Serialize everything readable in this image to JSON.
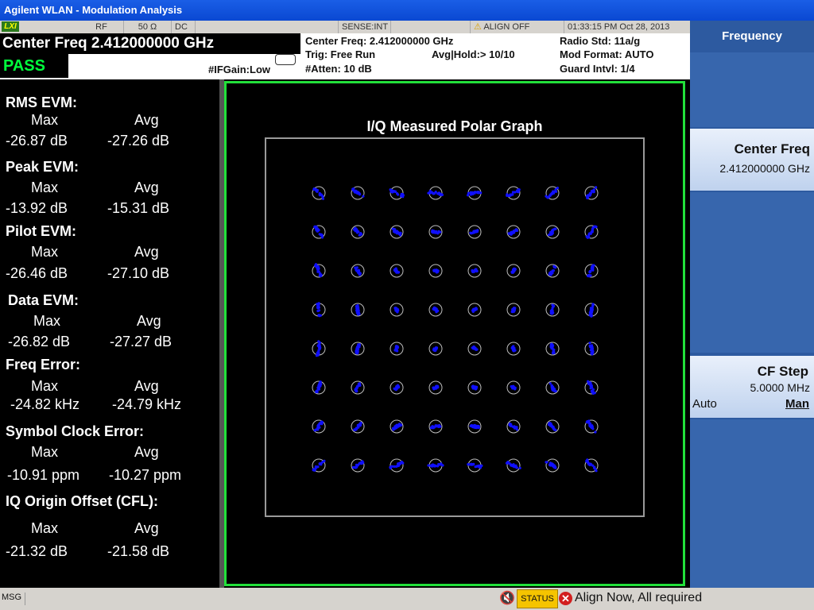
{
  "window": {
    "title": "Agilent WLAN - Modulation Analysis"
  },
  "status": {
    "lxi": "LXI",
    "rf": "RF",
    "impedance": "50 Ω",
    "coupling": "DC",
    "sense": "SENSE:INT",
    "align": "ALIGN OFF",
    "datetime": "01:33:15 PM Oct 28, 2013"
  },
  "header": {
    "center_freq": "Center Freq 2.412000000 GHz",
    "pass": "PASS",
    "ifgain": "#IFGain:Low",
    "info_center_freq": "Center Freq: 2.412000000 GHz",
    "trig": "Trig: Free Run",
    "avg_hold": "Avg|Hold:> 10/10",
    "atten": "#Atten: 10 dB",
    "radio_std": "Radio Std: 11a/g",
    "mod_format": "Mod Format: AUTO",
    "guard_intvl": "Guard Intvl: 1/4"
  },
  "results": {
    "col_max": "Max",
    "col_avg": "Avg",
    "rms_evm": {
      "label": "RMS EVM:",
      "max": "-26.87  dB",
      "avg": "-27.26  dB"
    },
    "peak_evm": {
      "label": "Peak EVM:",
      "max": "-13.92  dB",
      "avg": "-15.31  dB"
    },
    "pilot_evm": {
      "label": "Pilot EVM:",
      "max": "-26.46  dB",
      "avg": "-27.10  dB"
    },
    "data_evm": {
      "label": "Data EVM:",
      "max": "-26.82  dB",
      "avg": "-27.27  dB"
    },
    "freq_error": {
      "label": "Freq Error:",
      "max": "-24.82 kHz",
      "avg": "-24.79 kHz"
    },
    "symbol_clock": {
      "label": "Symbol Clock Error:",
      "max": "-10.91   ppm",
      "avg": "-10.27   ppm"
    },
    "iq_origin": {
      "label": "IQ Origin Offset (CFL):",
      "max": "-21.32  dB",
      "avg": "-21.58  dB"
    }
  },
  "graph": {
    "title": "I/Q Measured Polar Graph"
  },
  "chart_data": {
    "type": "scatter",
    "title": "I/Q Measured Polar Graph",
    "constellation": "64-QAM",
    "i_levels": [
      -7,
      -5,
      -3,
      -1,
      1,
      3,
      5,
      7
    ],
    "q_levels": [
      7,
      5,
      3,
      1,
      -1,
      -3,
      -5,
      -7
    ],
    "reference_marker": "circle",
    "sample_color": "#1010ff",
    "reference_color": "#bdbdbd"
  },
  "softkeys": {
    "menu_title": "Frequency",
    "center_freq": {
      "label": "Center Freq",
      "value": "2.412000000 GHz"
    },
    "cf_step": {
      "label": "CF Step",
      "value": "5.0000 MHz",
      "auto": "Auto",
      "man": "Man"
    }
  },
  "msgbar": {
    "msg": "MSG",
    "status": "STATUS",
    "error_text": "Align Now, All required"
  }
}
